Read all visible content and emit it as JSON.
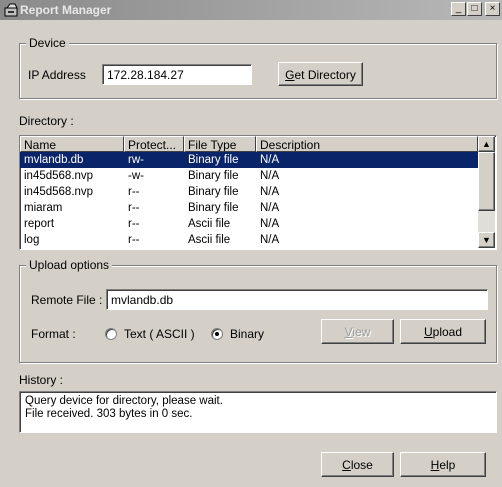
{
  "window": {
    "title": "Report Manager"
  },
  "device": {
    "legend": "Device",
    "ip_label": "IP Address",
    "ip_value": "172.28.184.27",
    "get_directory": "Get Directory"
  },
  "directory": {
    "label": "Directory :",
    "columns": [
      "Name",
      "Protect...",
      "File Type",
      "Description"
    ],
    "rows": [
      [
        "mvlandb.db",
        "rw-",
        "Binary file",
        "N/A"
      ],
      [
        "in45d568.nvp",
        "-w-",
        "Binary file",
        "N/A"
      ],
      [
        "in45d568.nvp",
        "r--",
        "Binary file",
        "N/A"
      ],
      [
        "miaram",
        "r--",
        "Binary file",
        "N/A"
      ],
      [
        "report",
        "r--",
        "Ascii file",
        "N/A"
      ],
      [
        "log",
        "r--",
        "Ascii file",
        "N/A"
      ]
    ],
    "selected_row": 0
  },
  "upload": {
    "legend": "Upload options",
    "remote_label": "Remote File :",
    "remote_value": "mvlandb.db",
    "format_label": "Format :",
    "option_text": "Text ( ASCII )",
    "option_binary": "Binary",
    "selected_format": "Binary",
    "view": "View",
    "upload": "Upload"
  },
  "history": {
    "label": "History :",
    "lines": [
      "Query device for directory, please wait.",
      "File received. 303 bytes in 0 sec."
    ]
  },
  "buttons": {
    "close": "Close",
    "help": "Help"
  },
  "title_buttons": {
    "minimize": "_",
    "maximize": "□",
    "close": "×"
  },
  "colors": {
    "selection": "#0a246a",
    "face": "#d4d0c8"
  }
}
